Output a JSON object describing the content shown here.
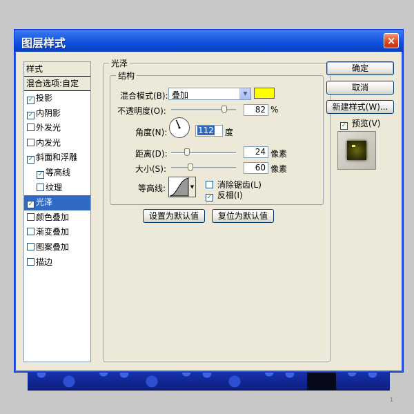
{
  "window": {
    "title": "图层样式",
    "close_icon": "×"
  },
  "styles": {
    "header": "样式",
    "blend_options": "混合选项:自定",
    "items": [
      {
        "label": "投影",
        "checked": true,
        "selected": false,
        "sub": false
      },
      {
        "label": "内阴影",
        "checked": true,
        "selected": false,
        "sub": false
      },
      {
        "label": "外发光",
        "checked": false,
        "selected": false,
        "sub": false
      },
      {
        "label": "内发光",
        "checked": false,
        "selected": false,
        "sub": false
      },
      {
        "label": "斜面和浮雕",
        "checked": true,
        "selected": false,
        "sub": false
      },
      {
        "label": "等高线",
        "checked": true,
        "selected": false,
        "sub": true
      },
      {
        "label": "纹理",
        "checked": false,
        "selected": false,
        "sub": true
      },
      {
        "label": "光泽",
        "checked": true,
        "selected": true,
        "sub": false
      },
      {
        "label": "颜色叠加",
        "checked": false,
        "selected": false,
        "sub": false
      },
      {
        "label": "渐变叠加",
        "checked": false,
        "selected": false,
        "sub": false
      },
      {
        "label": "图案叠加",
        "checked": false,
        "selected": false,
        "sub": false
      },
      {
        "label": "描边",
        "checked": false,
        "selected": false,
        "sub": false
      }
    ]
  },
  "satin": {
    "group_title": "光泽",
    "structure_title": "结构",
    "blend_mode_label": "混合模式(B):",
    "blend_mode_value": "叠加",
    "blend_color": "#ffff00",
    "opacity_label": "不透明度(O):",
    "opacity_value": "82",
    "opacity_unit": "%",
    "opacity_slider_pct": 82,
    "angle_label": "角度(N):",
    "angle_value": "112",
    "angle_unit": "度",
    "distance_label": "距离(D):",
    "distance_value": "24",
    "distance_unit": "像素",
    "distance_slider_pct": 24,
    "size_label": "大小(S):",
    "size_value": "60",
    "size_unit": "像素",
    "size_slider_pct": 30,
    "contour_label": "等高线:",
    "anti_alias_label": "消除锯齿(L)",
    "anti_alias_checked": false,
    "invert_label": "反相(I)",
    "invert_checked": true,
    "set_default_button": "设置为默认值",
    "reset_default_button": "复位为默认值"
  },
  "actions": {
    "ok_button": "确定",
    "cancel_button": "取消",
    "new_style_button": "新建样式(W)...",
    "preview_label": "预览(V)",
    "preview_checked": true
  },
  "check_mark": "✓",
  "dropdown_arrow": "▼",
  "page_number": "1"
}
